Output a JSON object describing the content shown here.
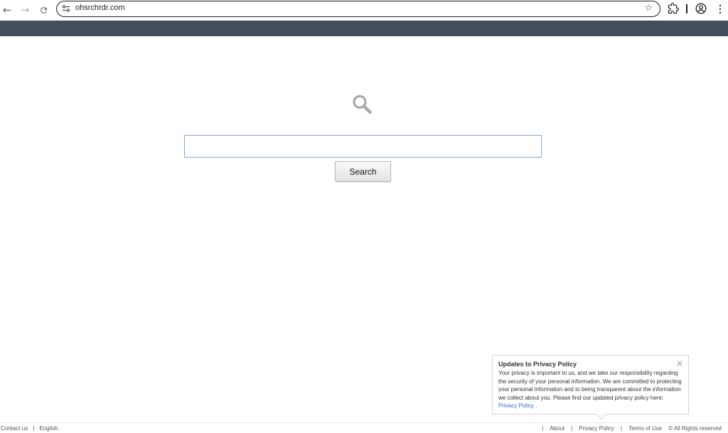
{
  "browser": {
    "url": "ohsrchrdr.com",
    "icons": {
      "back": "arrow-left-icon",
      "forward": "arrow-right-icon",
      "reload": "reload-icon",
      "site_info": "tune-icon",
      "bookmark": "star-icon",
      "extensions": "puzzle-icon",
      "profile": "account-circle-icon",
      "menu": "more-vert-icon"
    }
  },
  "main": {
    "search_button_label": "Search",
    "search_input_value": "",
    "logo_icon": "magnifier-icon"
  },
  "popup": {
    "title": "Updates to Privacy Policy",
    "body": "Your privacy is important to us, and we take our responsibility regarding the security of your personal information. We are committed to protecting your personal information and to being transparent about the information we collect about you. Please find our updated privacy policy here:",
    "link_text": "Privacy Policy",
    "trailing": ".",
    "close_glyph": "×"
  },
  "footer": {
    "contact": "Contact us",
    "language": "English",
    "about": "About",
    "privacy": "Privacy Policy",
    "terms": "Terms of Use",
    "rights": "© All Rights reserved",
    "separator": "|"
  },
  "colors": {
    "header_bar": "#434f5d",
    "input_border": "#7ea7d8",
    "link": "#2a6bc7"
  }
}
